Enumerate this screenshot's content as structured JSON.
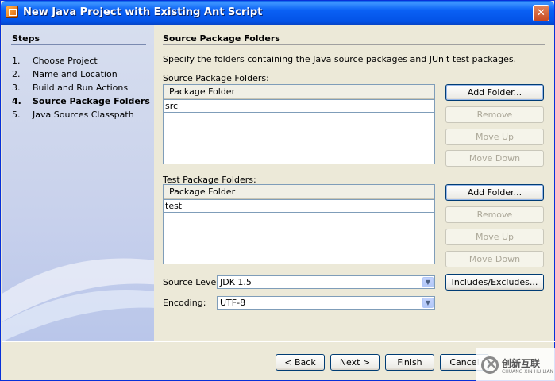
{
  "window": {
    "title": "New Java Project with Existing Ant Script",
    "close_glyph": "✕"
  },
  "steps": {
    "title": "Steps",
    "items": [
      {
        "num": "1.",
        "label": "Choose Project"
      },
      {
        "num": "2.",
        "label": "Name and Location"
      },
      {
        "num": "3.",
        "label": "Build and Run Actions"
      },
      {
        "num": "4.",
        "label": "Source Package Folders",
        "active": true
      },
      {
        "num": "5.",
        "label": "Java Sources Classpath"
      }
    ]
  },
  "panel": {
    "title": "Source Package Folders",
    "description": "Specify the folders containing the Java source packages and JUnit test packages.",
    "source_folders": {
      "label": "Source Package Folders:",
      "column_header": "Package Folder",
      "rows": [
        "src"
      ]
    },
    "test_folders": {
      "label": "Test Package Folders:",
      "column_header": "Package Folder",
      "rows": [
        "test"
      ]
    },
    "buttons": {
      "add_folder": "Add Folder...",
      "remove": "Remove",
      "move_up": "Move Up",
      "move_down": "Move Down",
      "includes_excludes": "Includes/Excludes..."
    },
    "source_level": {
      "label": "Source Level:",
      "value": "JDK 1.5"
    },
    "encoding": {
      "label": "Encoding:",
      "value": "UTF-8"
    }
  },
  "footer": {
    "back": "< Back",
    "next": "Next >",
    "finish": "Finish",
    "cancel": "Cancel"
  },
  "watermark": {
    "text": "创新互联",
    "sub": "CHUANG XIN HU LIAN"
  }
}
